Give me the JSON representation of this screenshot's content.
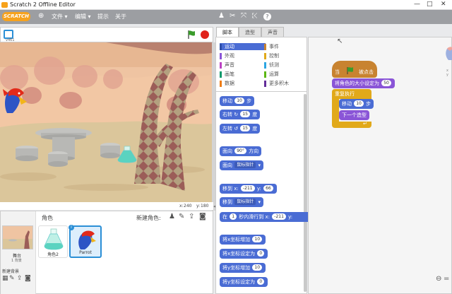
{
  "window": {
    "title": "Scratch 2 Offline Editor",
    "minimize": "—",
    "maximize": "□",
    "close": "✕"
  },
  "menubar": {
    "logo": "SCRATCH",
    "items": [
      "文件 ▾",
      "编辑 ▾",
      "提示",
      "关于"
    ],
    "icons": [
      "globe-icon",
      "duplicate-icon",
      "delete-icon",
      "grow-icon",
      "shrink-icon",
      "help-icon"
    ]
  },
  "stage": {
    "version": "v461",
    "coords": {
      "x_label": "x:",
      "x": "240",
      "y_label": "y:",
      "y": "180"
    }
  },
  "sprites": {
    "header": "角色",
    "new_sprite": "新建角色:",
    "stage_label": "舞台",
    "stage_backdrops": "1 背景",
    "new_backdrop": "新建背景",
    "items": [
      {
        "name": "角色2",
        "selected": false
      },
      {
        "name": "Parrot",
        "selected": true
      }
    ]
  },
  "tabs": [
    "脚本",
    "造型",
    "声音"
  ],
  "categories": [
    {
      "label": "运动",
      "color": "#4a6cd4",
      "active": true
    },
    {
      "label": "事件",
      "color": "#c88330",
      "active": false
    },
    {
      "label": "外观",
      "color": "#8a55d7",
      "active": false
    },
    {
      "label": "控制",
      "color": "#e1a91a",
      "active": false
    },
    {
      "label": "声音",
      "color": "#bb42c3",
      "active": false
    },
    {
      "label": "侦测",
      "color": "#2ca5e2",
      "active": false
    },
    {
      "label": "画笔",
      "color": "#0e9a6c",
      "active": false
    },
    {
      "label": "运算",
      "color": "#5cb712",
      "active": false
    },
    {
      "label": "数据",
      "color": "#ee7d16",
      "active": false
    },
    {
      "label": "更多积木",
      "color": "#632d99",
      "active": false
    }
  ],
  "palette_blocks": {
    "move": {
      "a": "移动",
      "v": "10",
      "b": "步"
    },
    "turn_right": {
      "a": "右转",
      "v": "15",
      "b": "度"
    },
    "turn_left": {
      "a": "左转",
      "v": "15",
      "b": "度"
    },
    "point_dir": {
      "a": "面向",
      "v": "90°",
      "b": "方向"
    },
    "point_to": {
      "a": "面向",
      "d": "鼠标指针"
    },
    "goto_xy": {
      "a": "移到",
      "xl": "x:",
      "x": "-211",
      "yl": "y:",
      "y": "66"
    },
    "goto": {
      "a": "移到",
      "d": "鼠标指针"
    },
    "glide": {
      "a": "在",
      "t": "1",
      "b": "秒内滑行到",
      "xl": "x:",
      "x": "-211",
      "yl": "y:"
    },
    "change_x": {
      "a": "将x坐标增加",
      "v": "10"
    },
    "set_x": {
      "a": "将x坐标设定为",
      "v": "0"
    },
    "change_y": {
      "a": "将y坐标增加",
      "v": "10"
    },
    "set_y": {
      "a": "将y坐标设定为",
      "v": "0"
    }
  },
  "script": {
    "hat": {
      "a": "当",
      "b": "被点击"
    },
    "set_size": {
      "a": "将角色的大小设定为",
      "v": "50"
    },
    "forever": "重复执行",
    "move": {
      "a": "移动",
      "v": "10",
      "b": "步"
    },
    "next_costume": "下一个造型"
  },
  "colors": {
    "motion": "#4a6cd4",
    "looks": "#8a55d7",
    "control": "#e1a91a",
    "events": "#c88330",
    "selected_sprite": "#2b8fd6"
  }
}
